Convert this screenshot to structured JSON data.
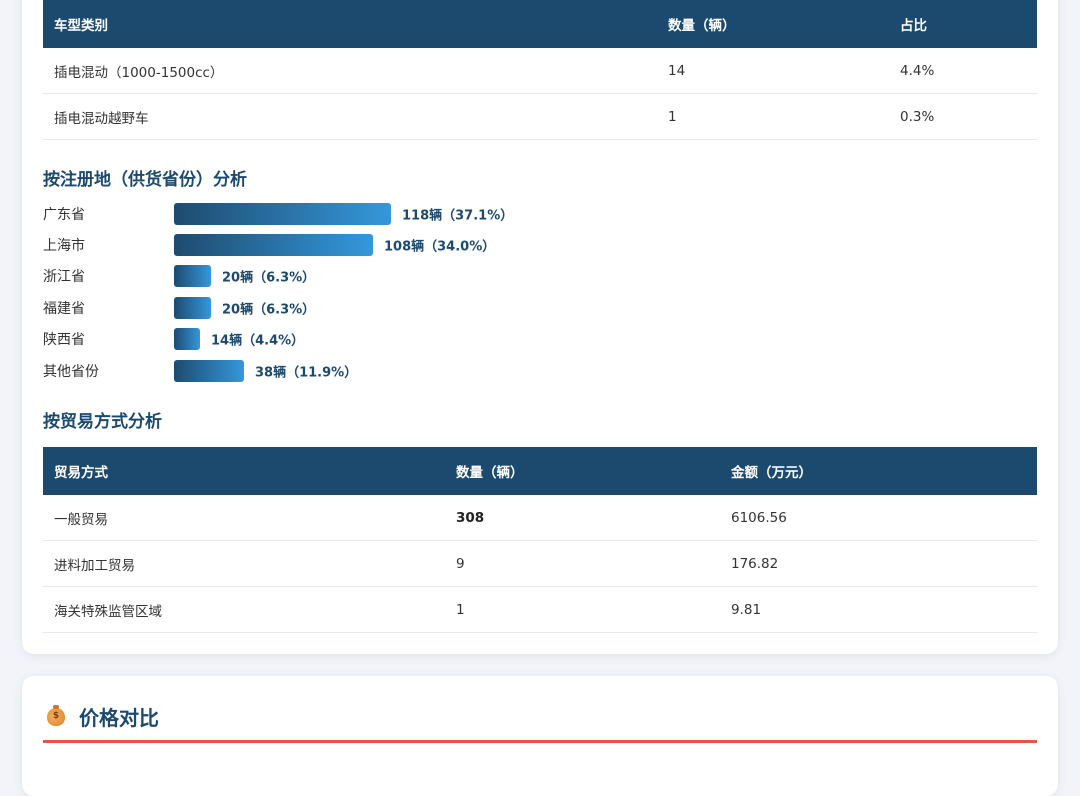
{
  "vehicle_table": {
    "headers": [
      "车型类别",
      "数量（辆）",
      "占比"
    ],
    "rows": [
      [
        "插电混动（1000-1500cc）",
        "14",
        "4.4%"
      ],
      [
        "插电混动越野车",
        "1",
        "0.3%"
      ]
    ]
  },
  "province_section": {
    "title": "按注册地（供货省份）分析",
    "items": [
      {
        "label": "广东省",
        "value_text": "118辆（37.1%）",
        "count": 118,
        "percent": 37.1
      },
      {
        "label": "上海市",
        "value_text": "108辆（34.0%）",
        "count": 108,
        "percent": 34.0
      },
      {
        "label": "浙江省",
        "value_text": "20辆（6.3%）",
        "count": 20,
        "percent": 6.3
      },
      {
        "label": "福建省",
        "value_text": "20辆（6.3%）",
        "count": 20,
        "percent": 6.3
      },
      {
        "label": "陕西省",
        "value_text": "14辆（4.4%）",
        "count": 14,
        "percent": 4.4
      },
      {
        "label": "其他省份",
        "value_text": "38辆（11.9%）",
        "count": 38,
        "percent": 11.9
      }
    ]
  },
  "trade_section": {
    "title": "按贸易方式分析",
    "headers": [
      "贸易方式",
      "数量（辆）",
      "金额（万元）"
    ],
    "rows": [
      [
        "一般贸易",
        "308",
        "6106.56"
      ],
      [
        "进料加工贸易",
        "9",
        "176.82"
      ],
      [
        "海关特殊监管区域",
        "1",
        "9.81"
      ]
    ]
  },
  "price_section": {
    "icon": "money-bag-icon",
    "title": "价格对比"
  },
  "colors": {
    "header_bg": "#1c4a6e",
    "bar_start": "#1e4b6f",
    "bar_end": "#3498db",
    "accent_line": "#e2574c"
  }
}
